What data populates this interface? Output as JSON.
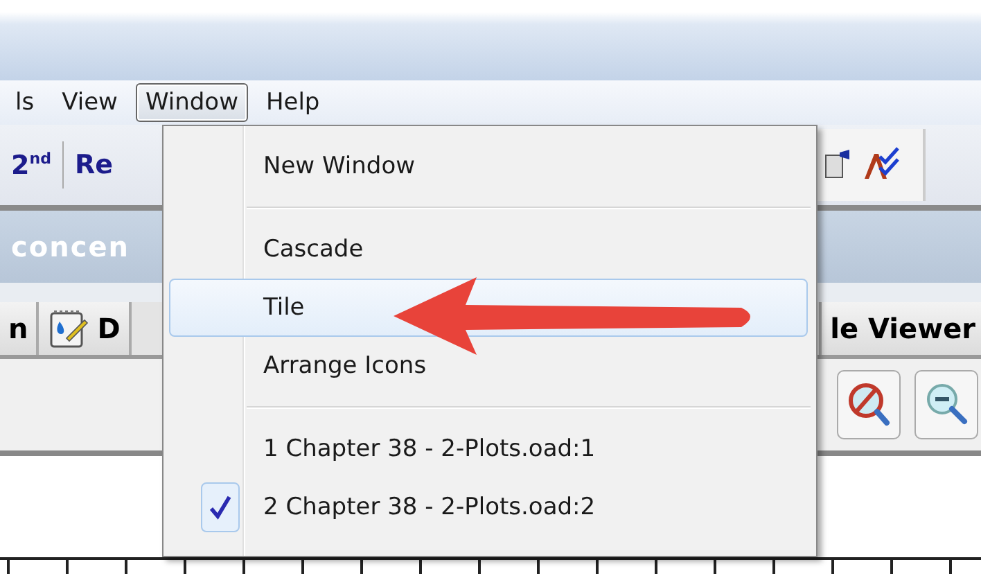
{
  "menubar": [
    {
      "label": "ls",
      "selected": false
    },
    {
      "label": "View",
      "selected": false
    },
    {
      "label": "Window",
      "selected": true
    },
    {
      "label": "Help",
      "selected": false
    }
  ],
  "toolbar": {
    "buttons": [
      "2$^{nd}$",
      "Re"
    ]
  },
  "document_title": "concen",
  "tabs": [
    {
      "label": "n"
    },
    {
      "label": "D"
    },
    {
      "label": "le Viewer"
    }
  ],
  "window_menu": {
    "sections": [
      {
        "items": [
          {
            "label": "New Window",
            "selected": false,
            "checked": false
          }
        ]
      },
      {
        "items": [
          {
            "label": "Cascade",
            "selected": false,
            "checked": false
          },
          {
            "label": "Tile",
            "selected": true,
            "checked": false
          },
          {
            "label": "Arrange Icons",
            "selected": false,
            "checked": false
          }
        ]
      },
      {
        "items": [
          {
            "label": "1 Chapter 38 - 2-Plots.oad:1",
            "selected": false,
            "checked": false
          },
          {
            "label": "2 Chapter 38 - 2-Plots.oad:2",
            "selected": false,
            "checked": true
          }
        ]
      }
    ]
  }
}
